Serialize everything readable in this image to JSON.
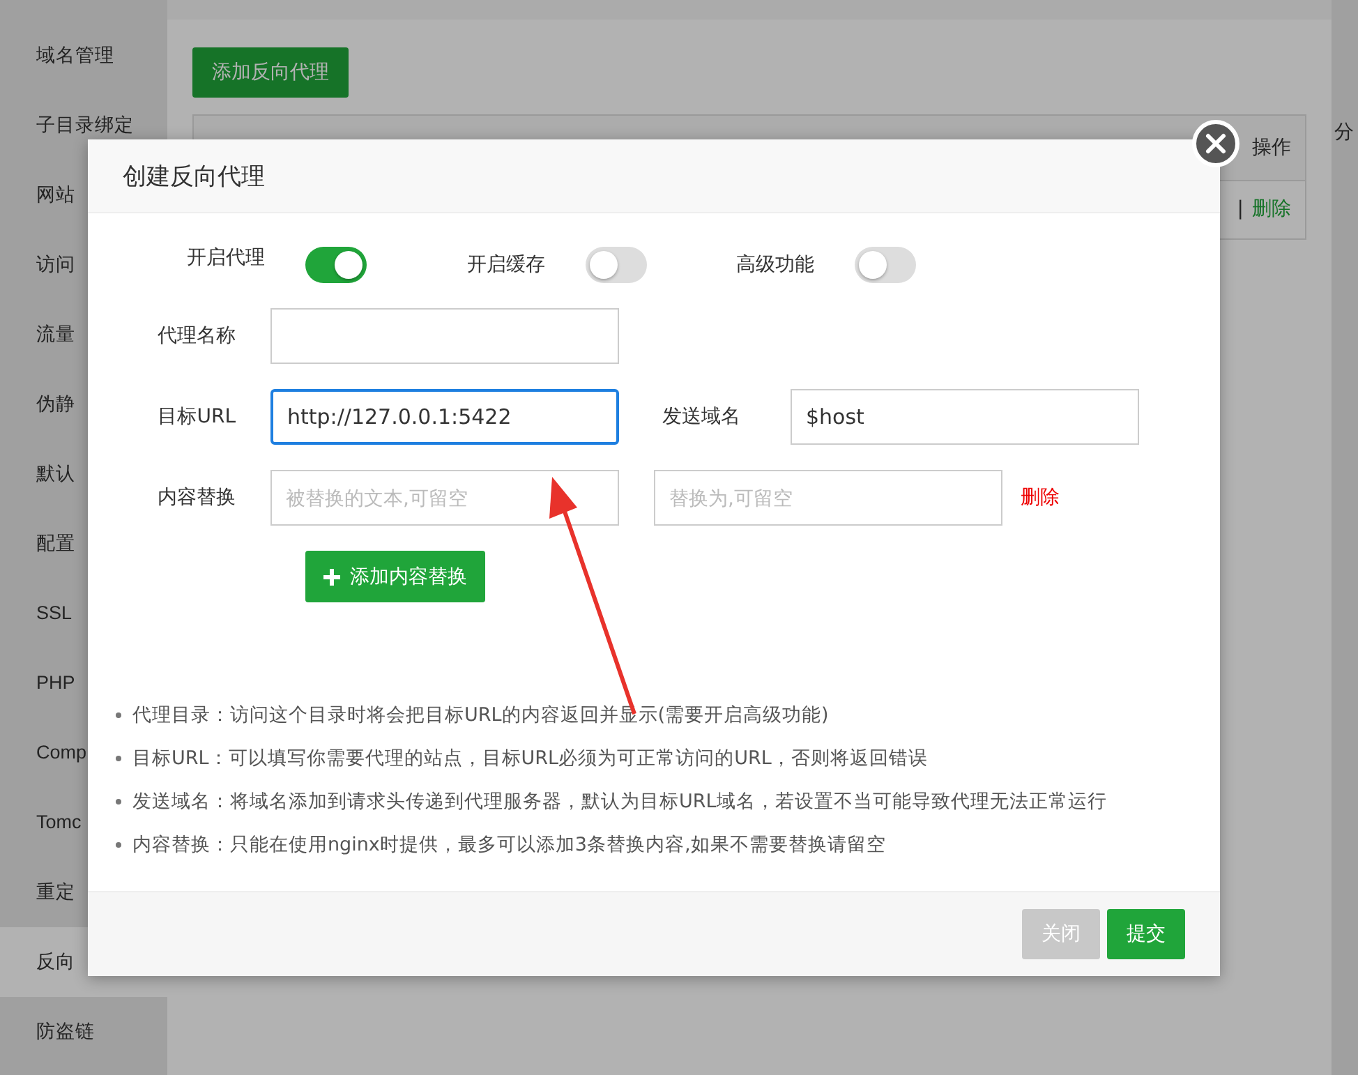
{
  "sidebar": {
    "items": [
      {
        "label": "域名管理",
        "selected": false
      },
      {
        "label": "子目录绑定",
        "selected": false
      },
      {
        "label": "网站",
        "selected": false
      },
      {
        "label": "访问",
        "selected": false
      },
      {
        "label": "流量",
        "selected": false
      },
      {
        "label": "伪静",
        "selected": false
      },
      {
        "label": "默认",
        "selected": false
      },
      {
        "label": "配置",
        "selected": false
      },
      {
        "label": "SSL",
        "selected": false
      },
      {
        "label": "PHP",
        "selected": false
      },
      {
        "label": "Comp",
        "selected": false
      },
      {
        "label": "Tomc",
        "selected": false
      },
      {
        "label": "重定",
        "selected": false
      },
      {
        "label": "反向",
        "selected": true
      },
      {
        "label": "防盗链",
        "selected": false
      }
    ]
  },
  "page": {
    "add_button": "添加反向代理",
    "table": {
      "header_action": "操作",
      "row_action": "删除",
      "separator": "|"
    },
    "edge_text": "分"
  },
  "dialog": {
    "title": "创建反向代理",
    "toggles": [
      {
        "label": "开启代理",
        "on": true
      },
      {
        "label": "开启缓存",
        "on": false
      },
      {
        "label": "高级功能",
        "on": false
      }
    ],
    "name_field": {
      "label": "代理名称"
    },
    "url_field": {
      "label": "目标URL",
      "value": "http://127.0.0.1:5422",
      "focused": true
    },
    "host_field": {
      "label": "发送域名",
      "value": "$host",
      "focused": false
    },
    "replace": {
      "label": "内容替换",
      "from_placeholder": "被替换的文本,可留空",
      "to_placeholder": "替换为,可留空",
      "delete": "删除"
    },
    "add_replace_button": "添加内容替换",
    "notes": [
      "代理目录：访问这个目录时将会把目标URL的内容返回并显示(需要开启高级功能)",
      "目标URL：可以填写你需要代理的站点，目标URL必须为可正常访问的URL，否则将返回错误",
      "发送域名：将域名添加到请求头传递到代理服务器，默认为目标URL域名，若设置不当可能导致代理无法正常运行",
      "内容替换：只能在使用nginx时提供，最多可以添加3条替换内容,如果不需要替换请留空"
    ],
    "buttons": [
      {
        "label": "关闭",
        "disabled": true
      },
      {
        "label": "提交",
        "disabled": false
      }
    ]
  }
}
